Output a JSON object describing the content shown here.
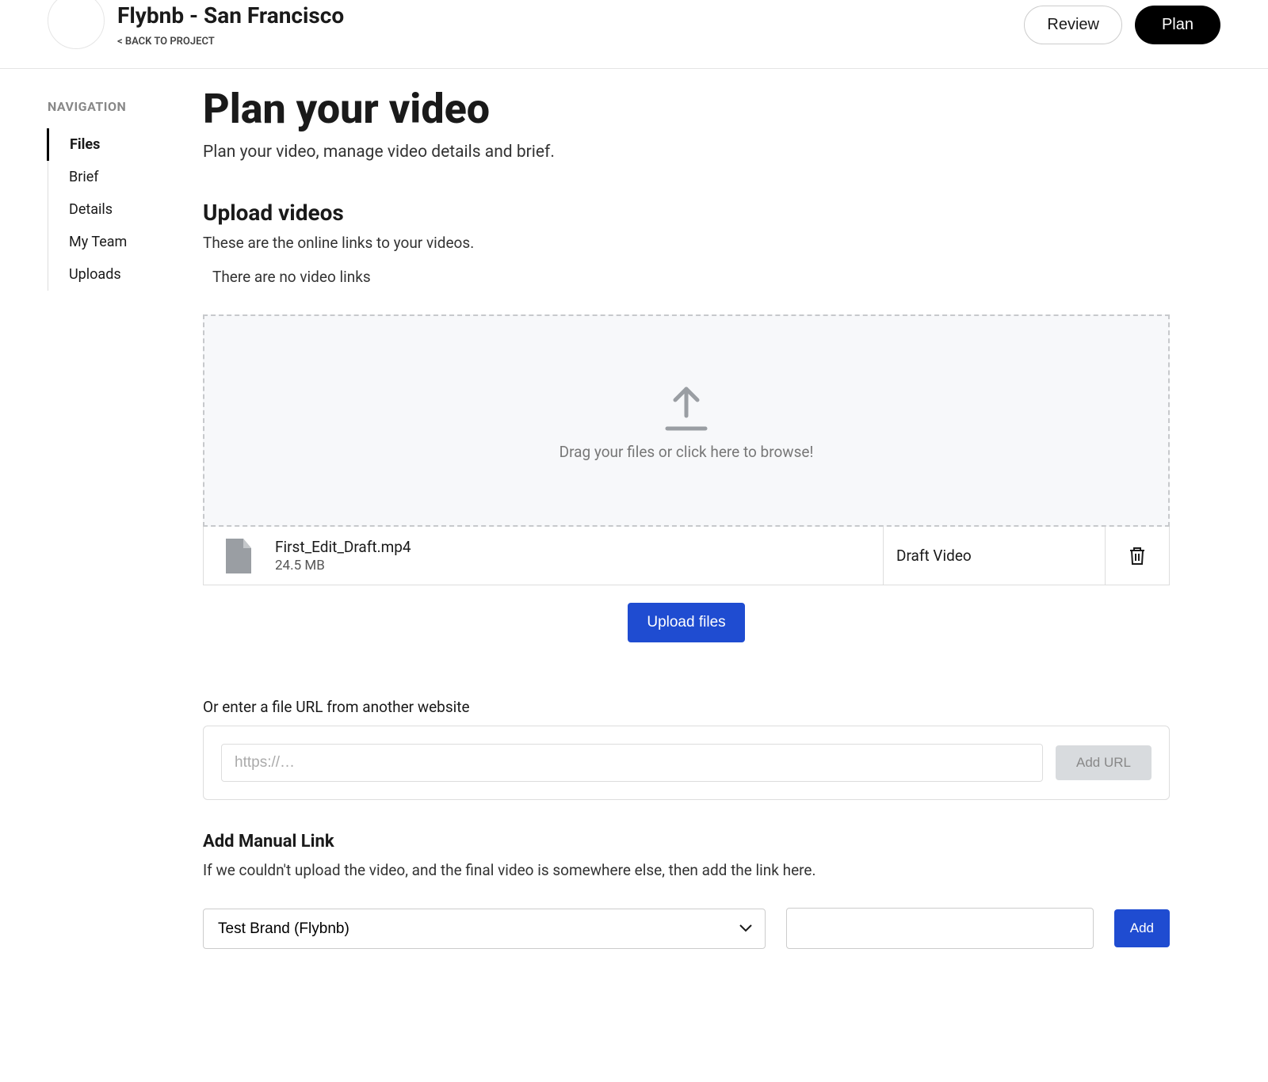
{
  "header": {
    "title": "Flybnb - San Francisco",
    "back_label": "< BACK TO PROJECT",
    "review_label": "Review",
    "plan_label": "Plan"
  },
  "sidebar": {
    "heading": "NAVIGATION",
    "items": [
      {
        "label": "Files",
        "active": true
      },
      {
        "label": "Brief",
        "active": false
      },
      {
        "label": "Details",
        "active": false
      },
      {
        "label": "My Team",
        "active": false
      },
      {
        "label": "Uploads",
        "active": false
      }
    ]
  },
  "page": {
    "title": "Plan your video",
    "subtitle": "Plan your video, manage video details and brief."
  },
  "upload": {
    "heading": "Upload videos",
    "subheading": "These are the online links to your videos.",
    "empty_message": "There are no video links",
    "dropzone_text": "Drag your files or click here to browse!",
    "files": [
      {
        "name": "First_Edit_Draft.mp4",
        "size": "24.5 MB",
        "kind": "Draft Video"
      }
    ],
    "upload_button_label": "Upload files"
  },
  "url_section": {
    "label": "Or enter a file URL from another website",
    "placeholder": "https://…",
    "button_label": "Add URL"
  },
  "manual": {
    "heading": "Add Manual Link",
    "subheading": "If we couldn't upload the video, and the final video is somewhere else, then add the link here.",
    "brand_selected": "Test Brand (Flybnb)",
    "add_label": "Add"
  }
}
